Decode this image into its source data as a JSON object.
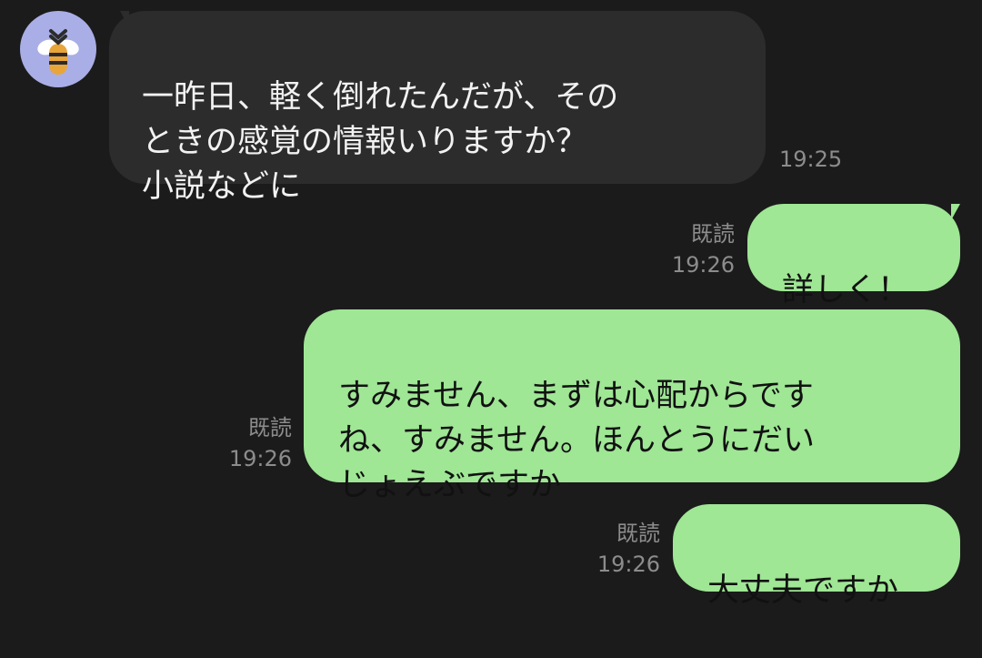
{
  "messages": [
    {
      "direction": "incoming",
      "text": "一昨日、軽く倒れたんだが、その\nときの感覚の情報いりますか？\n小説などに",
      "time": "19:25"
    },
    {
      "direction": "outgoing",
      "text": "詳しく！",
      "read": "既読",
      "time": "19:26"
    },
    {
      "direction": "outgoing",
      "text": "すみません、まずは心配からです\nね、すみません。ほんとうにだい\nじょえぶですか",
      "read": "既読",
      "time": "19:26"
    },
    {
      "direction": "outgoing",
      "text": "大丈夫ですか",
      "read": "既読",
      "time": "19:26"
    }
  ],
  "colors": {
    "background": "#1b1b1b",
    "incoming_bubble": "#2c2c2c",
    "outgoing_bubble": "#9fe695",
    "meta_text": "#8c8c8c",
    "avatar_bg": "#a9aee6"
  },
  "icons": {
    "avatar": "bee-icon"
  }
}
